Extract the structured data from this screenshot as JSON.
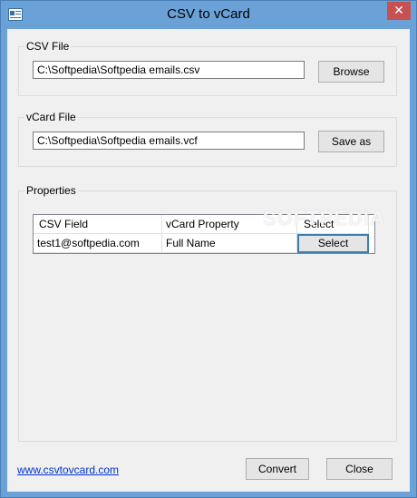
{
  "window": {
    "title": "CSV to vCard",
    "close_glyph": "✕"
  },
  "csv_group": {
    "label": "CSV File",
    "path": "C:\\Softpedia\\Softpedia emails.csv",
    "browse_label": "Browse"
  },
  "vcard_group": {
    "label": "vCard File",
    "path": "C:\\Softpedia\\Softpedia emails.vcf",
    "saveas_label": "Save as"
  },
  "properties": {
    "label": "Properties",
    "columns": [
      "CSV Field",
      "vCard Property",
      "Select"
    ],
    "rows": [
      {
        "csv_field": "test1@softpedia.com",
        "vcard_property": "Full Name",
        "select_label": "Select"
      }
    ]
  },
  "footer": {
    "link_text": "www.csvtovcard.com",
    "convert_label": "Convert",
    "close_label": "Close"
  },
  "watermark": "SOFTPEDIA"
}
